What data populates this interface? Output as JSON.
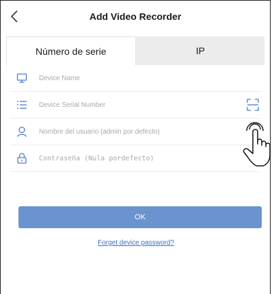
{
  "header": {
    "title": "Add Video Recorder"
  },
  "tabs": [
    {
      "label": "Número de serie",
      "active": true
    },
    {
      "label": "IP",
      "active": false
    }
  ],
  "form": {
    "device_name": {
      "placeholder": "Device Name",
      "value": ""
    },
    "serial_number": {
      "placeholder": "Device Serial Number",
      "value": ""
    },
    "username": {
      "placeholder": "Nombre del usuario (admin por defecto)",
      "value": ""
    },
    "password": {
      "placeholder": "Contraseña (Nula pordefecto)",
      "value": ""
    }
  },
  "ok_button": {
    "label": "OK"
  },
  "forgot_link": {
    "label": "Forget device password?"
  },
  "colors": {
    "accent": "#6b93cf",
    "link": "#3a6fc4",
    "icon": "#4a7ccf",
    "tab_inactive_bg": "#ececec"
  },
  "icons": [
    "chevron-left-icon",
    "monitor-icon",
    "list-icon",
    "user-icon",
    "lock-icon",
    "scan-icon",
    "hand-pointer-icon"
  ]
}
